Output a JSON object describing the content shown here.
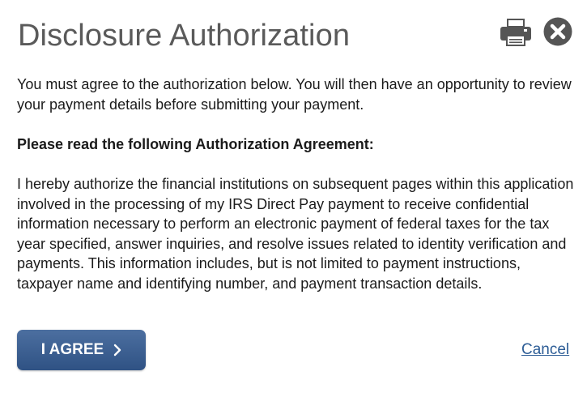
{
  "dialog": {
    "title": "Disclosure Authorization",
    "print_icon": "printer-icon",
    "close_icon": "close-circle-icon",
    "intro": "You must agree to the authorization below. You will then have an opportunity to review your payment details before submitting your payment.",
    "agreement_heading": "Please read the following Authorization Agreement:",
    "agreement_text": "I hereby authorize the financial institutions on subsequent pages within this application involved in the processing of my IRS Direct Pay payment to receive confidential information necessary to perform an electronic payment of federal taxes for the tax year specified, answer inquiries, and resolve issues related to identity verification and payments. This information includes, but is not limited to payment instructions, taxpayer name and identifying number, and payment transaction details.",
    "agree_button": {
      "label": "I AGREE",
      "icon": "chevron-right-icon"
    },
    "cancel_link": "Cancel"
  },
  "colors": {
    "title": "#5a5a5a",
    "body_text": "#1b1b1b",
    "button_bg_top": "#4c6fa0",
    "button_bg_bottom": "#2f5284",
    "link": "#2d5d96",
    "icon": "#555555"
  }
}
